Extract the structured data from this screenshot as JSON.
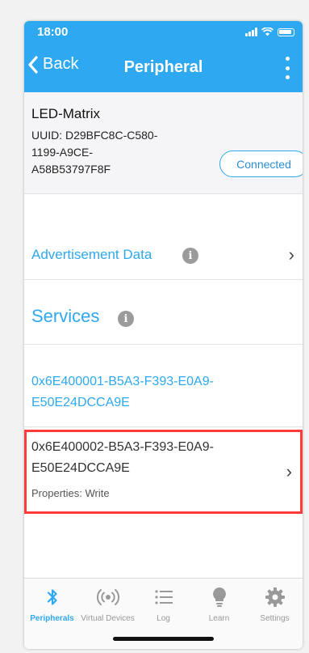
{
  "status_bar": {
    "time": "18:00"
  },
  "nav": {
    "back_label": "Back",
    "title": "Peripheral"
  },
  "device": {
    "name": "LED-Matrix",
    "uuid": "UUID: D29BFC8C-C580-1199-A9CE-A58B53797F8F",
    "status": "Connected"
  },
  "advertisement": {
    "label": "Advertisement Data"
  },
  "services": {
    "title": "Services",
    "items": [
      {
        "uuid": "0x6E400001-B5A3-F393-E0A9-E50E24DCCA9E"
      },
      {
        "uuid": "0x6E400002-B5A3-F393-E0A9-E50E24DCCA9E",
        "properties": "Properties: Write"
      }
    ]
  },
  "tabs": [
    {
      "label": "Peripherals",
      "icon": "bluetooth-icon",
      "active": true
    },
    {
      "label": "Virtual Devices",
      "icon": "broadcast-icon",
      "active": false
    },
    {
      "label": "Log",
      "icon": "list-icon",
      "active": false
    },
    {
      "label": "Learn",
      "icon": "lightbulb-icon",
      "active": false
    },
    {
      "label": "Settings",
      "icon": "gear-icon",
      "active": false
    }
  ],
  "colors": {
    "accent": "#2ea8f0",
    "highlight_border": "#ff3b3b"
  }
}
